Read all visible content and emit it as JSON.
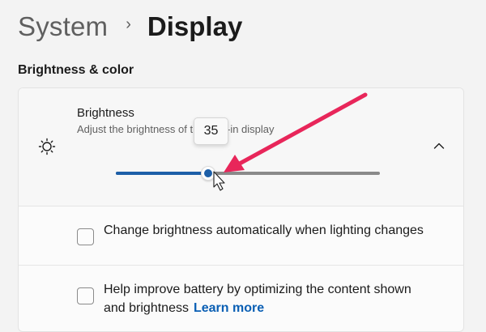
{
  "breadcrumb": {
    "parent": "System",
    "separator": "›",
    "current": "Display"
  },
  "section": {
    "title": "Brightness & color"
  },
  "brightness": {
    "title": "Brightness",
    "description": "Adjust the brightness of the built-in display",
    "value": "35",
    "slider_fraction": 0.35,
    "icon": "sun-icon",
    "expand_icon": "chevron-up-icon"
  },
  "options": {
    "auto": {
      "label": "Change brightness automatically when lighting changes",
      "checked": false
    },
    "battery": {
      "label": "Help improve battery by optimizing the content shown and brightness",
      "link": "Learn more",
      "checked": false
    }
  },
  "colors": {
    "accent": "#1d5fa8",
    "annotation_arrow": "#e8265a",
    "link": "#0a5fb4"
  }
}
